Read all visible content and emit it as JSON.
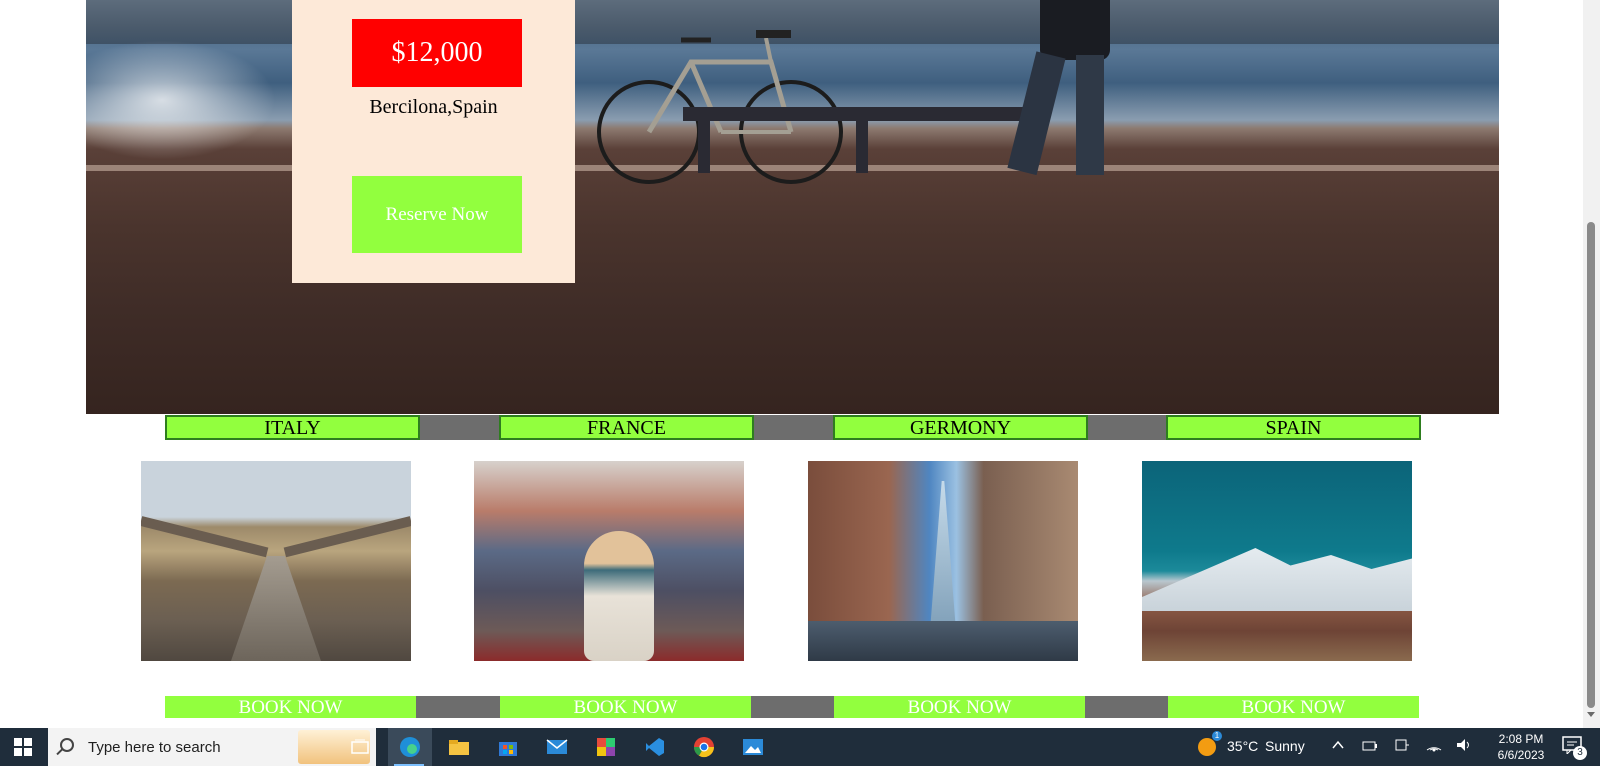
{
  "hero": {
    "price": "$12,000",
    "location": "Bercilona,Spain",
    "reserve_label": "Reserve Now"
  },
  "countries": [
    "ITALY",
    "FRANCE",
    "GERMONY",
    "SPAIN"
  ],
  "book_labels": [
    "BOOK NOW",
    "BOOK NOW",
    "BOOK NOW",
    "BOOK NOW"
  ],
  "colors": {
    "price_badge": "#ff0000",
    "accent_green": "#92ff3e",
    "card_bg": "#fde9d8",
    "bar_gray": "#6d6d6d"
  },
  "taskbar": {
    "search_placeholder": "Type here to search",
    "apps": [
      "task-view-icon",
      "edge-icon",
      "file-explorer-icon",
      "store-icon",
      "mail-icon",
      "office-icon",
      "vscode-icon",
      "chrome-icon",
      "photos-icon"
    ],
    "weather_temp": "35°C",
    "weather_desc": "Sunny",
    "weather_badge": "1",
    "time": "2:08 PM",
    "date": "6/6/2023",
    "notification_count": "3"
  }
}
